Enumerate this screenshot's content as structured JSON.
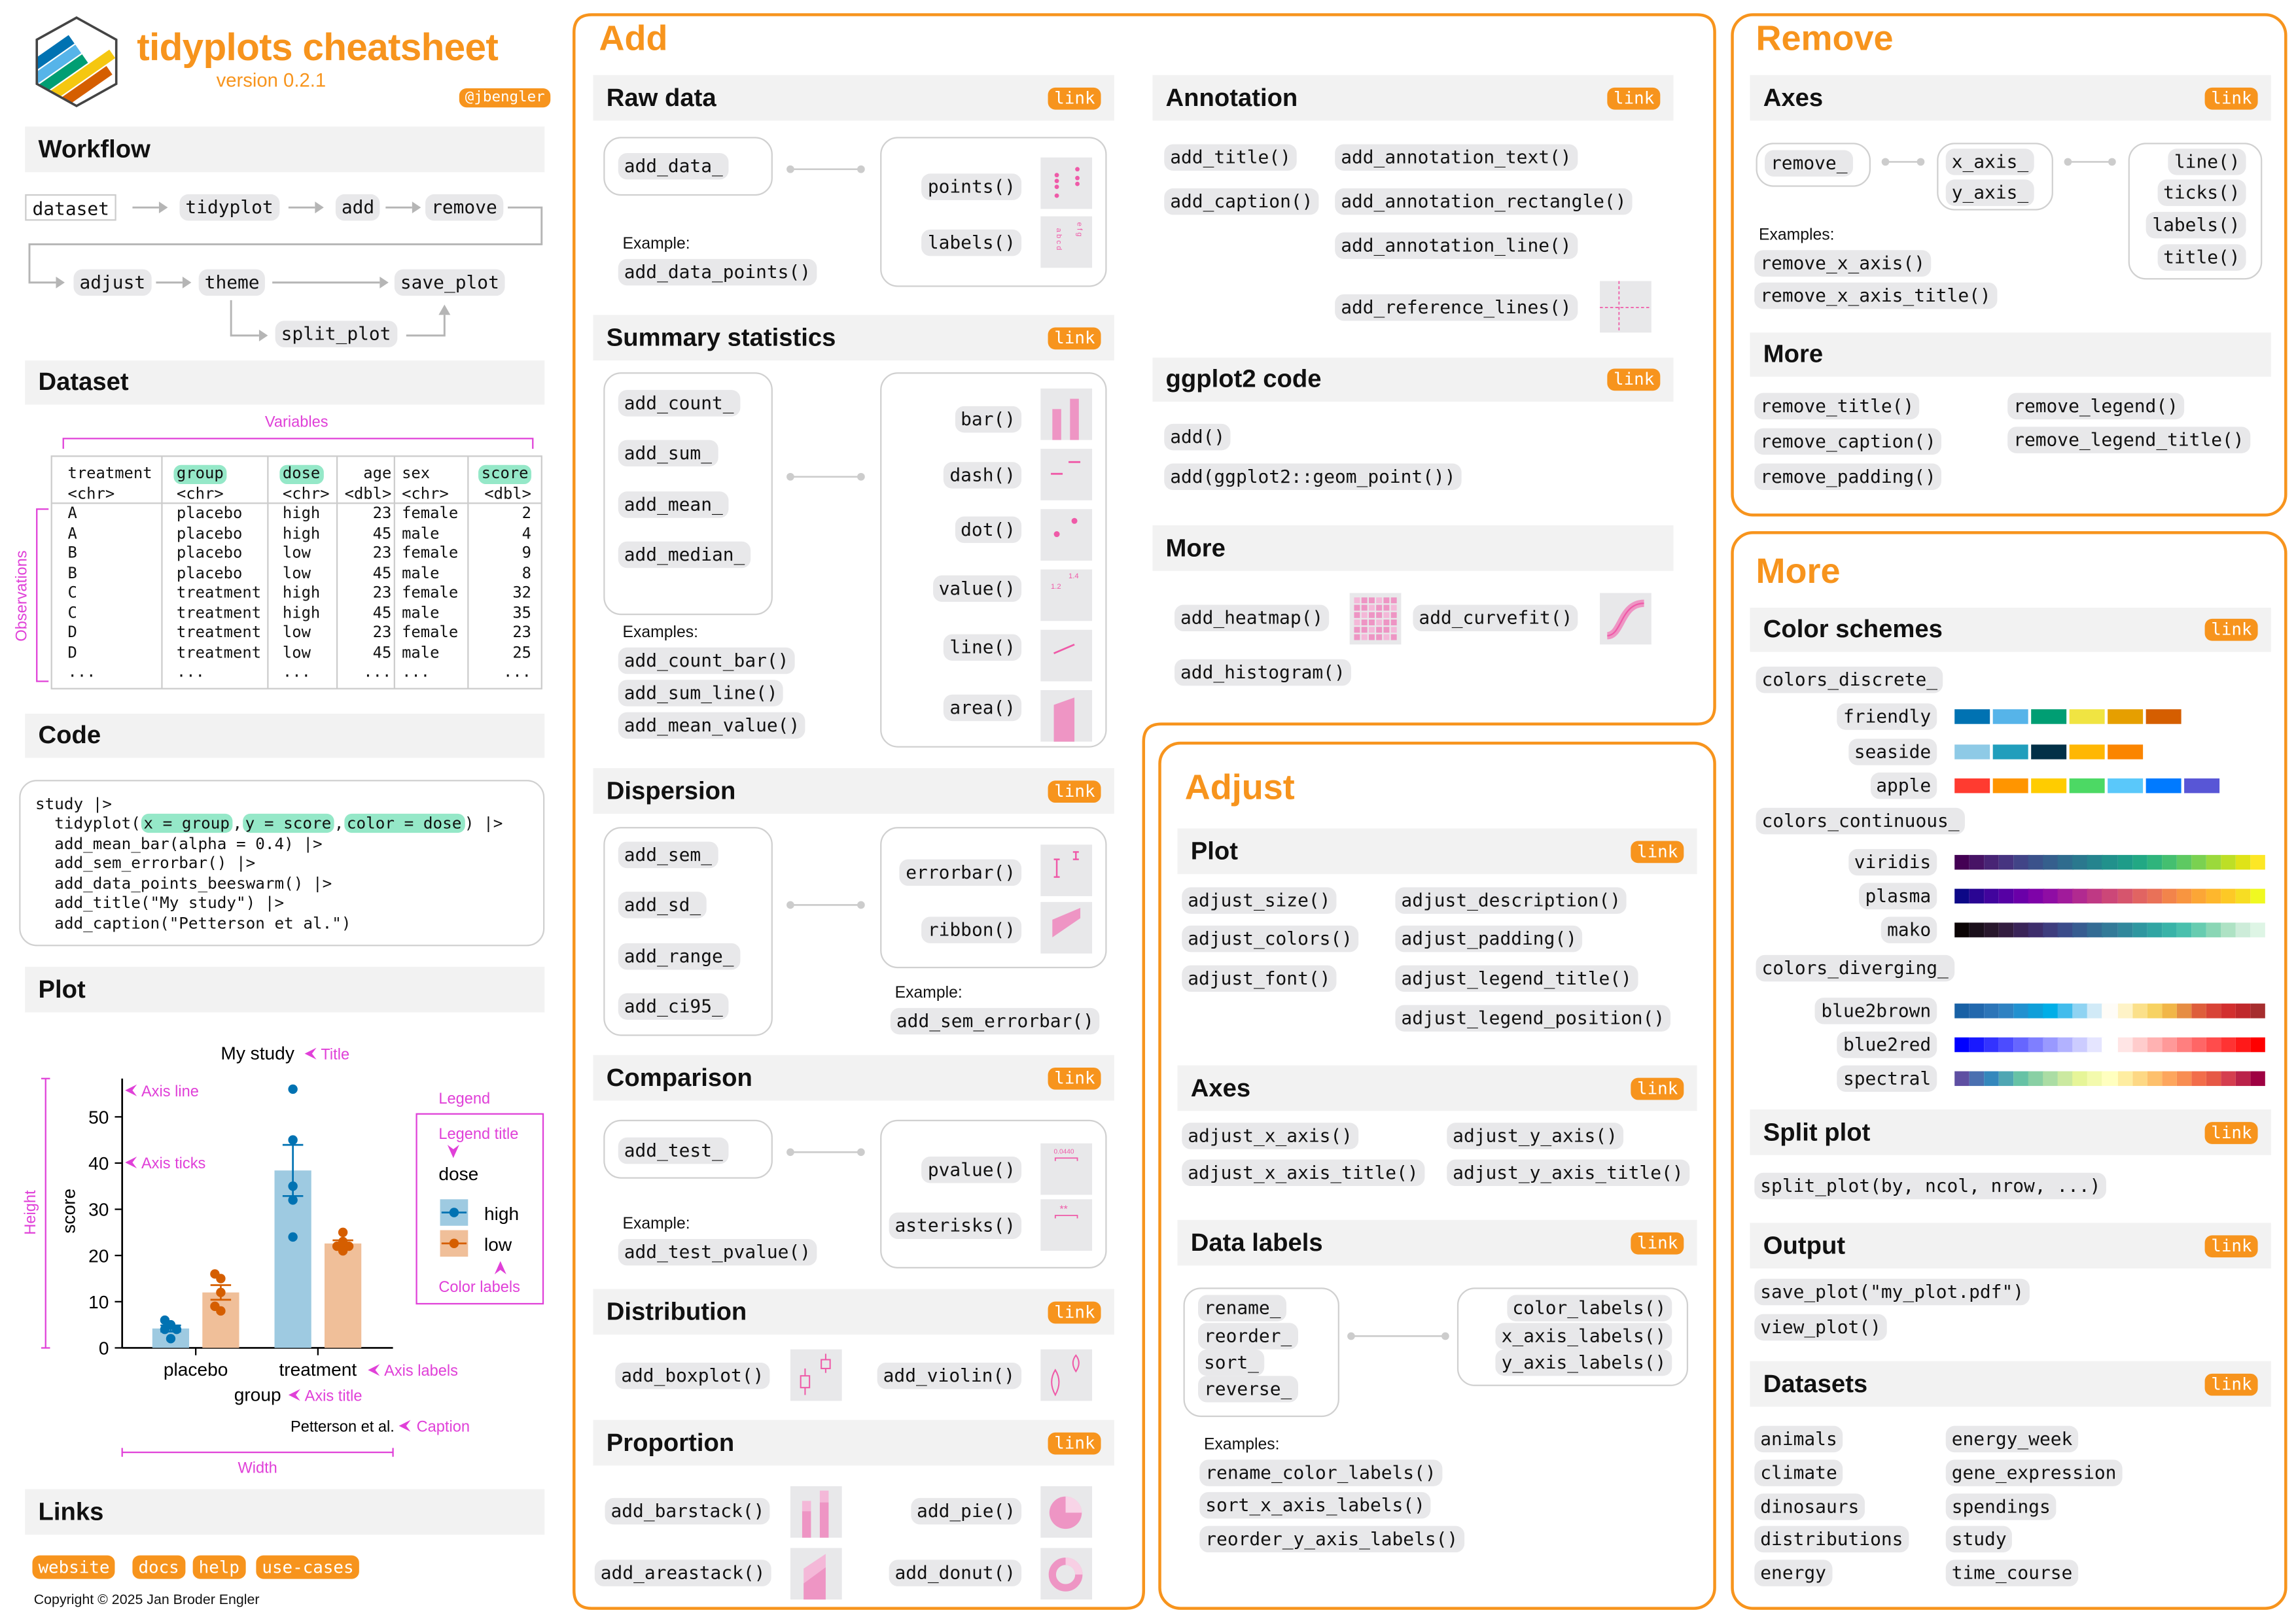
{
  "header": {
    "title": "tidyplots cheatsheet",
    "version": "version 0.2.1",
    "handle": "@jbengler",
    "logo_text": "tidy plots"
  },
  "link_label": "link",
  "brand_color": "#f7941d",
  "annotation_color": "#e040d8",
  "workflow": {
    "title": "Workflow",
    "steps": [
      "dataset",
      "tidyplot",
      "add",
      "remove",
      "adjust",
      "theme",
      "save_plot",
      "split_plot"
    ]
  },
  "dataset": {
    "title": "Dataset",
    "variables_label": "Variables",
    "observations_label": "Observations",
    "columns": [
      {
        "name": "treatment",
        "type": "<chr>",
        "highlight": false
      },
      {
        "name": "group",
        "type": "<chr>",
        "highlight": true
      },
      {
        "name": "dose",
        "type": "<chr>",
        "highlight": true
      },
      {
        "name": "age",
        "type": "<dbl>",
        "highlight": false
      },
      {
        "name": "sex",
        "type": "<chr>",
        "highlight": false
      },
      {
        "name": "score",
        "type": "<dbl>",
        "highlight": true
      }
    ],
    "rows": [
      [
        "A",
        "placebo",
        "high",
        "23",
        "female",
        "2"
      ],
      [
        "A",
        "placebo",
        "high",
        "45",
        "male",
        "4"
      ],
      [
        "B",
        "placebo",
        "low",
        "23",
        "female",
        "9"
      ],
      [
        "B",
        "placebo",
        "low",
        "45",
        "male",
        "8"
      ],
      [
        "C",
        "treatment",
        "high",
        "23",
        "female",
        "32"
      ],
      [
        "C",
        "treatment",
        "high",
        "45",
        "male",
        "35"
      ],
      [
        "D",
        "treatment",
        "low",
        "23",
        "female",
        "23"
      ],
      [
        "D",
        "treatment",
        "low",
        "45",
        "male",
        "25"
      ],
      [
        "...",
        "...",
        "...",
        "...",
        "...",
        "..."
      ]
    ]
  },
  "code": {
    "title": "Code",
    "line1": "study |>",
    "line2": {
      "a": "tidyplot(",
      "x": "x = group",
      "c1": ",",
      "y": "y = score",
      "c2": ",",
      "color": "color = dose",
      "end": ") |>"
    },
    "lines": [
      "add_mean_bar(alpha = 0.4) |>",
      "add_sem_errorbar() |>",
      "add_data_points_beeswarm() |>",
      "add_title(\"My study\") |>",
      "add_caption(\"Petterson et al.\")"
    ]
  },
  "plot": {
    "title": "Plot",
    "annotations": {
      "title": "Title",
      "axis_line": "Axis line",
      "axis_ticks": "Axis ticks",
      "legend": "Legend",
      "legend_title": "Legend title",
      "color_labels": "Color labels",
      "axis_labels": "Axis labels",
      "axis_title": "Axis title",
      "caption": "Caption",
      "width": "Width",
      "height": "Height"
    }
  },
  "chart_data": {
    "type": "bar",
    "title": "My study",
    "xlabel": "group",
    "ylabel": "score",
    "caption": "Petterson et al.",
    "categories": [
      "placebo",
      "treatment"
    ],
    "yticks": [
      0,
      10,
      20,
      30,
      40,
      50
    ],
    "ylim": [
      0,
      58
    ],
    "grid": false,
    "legend": {
      "title": "dose",
      "position": "right"
    },
    "series": [
      {
        "name": "high",
        "color": "#0072B2",
        "bar_color": "#9ecae1",
        "mean": [
          4.2,
          38.4
        ],
        "points": [
          [
            6,
            5,
            4,
            4,
            2
          ],
          [
            56,
            45,
            35,
            32,
            24
          ]
        ]
      },
      {
        "name": "low",
        "color": "#D55E00",
        "bar_color": "#f0bf99",
        "mean": [
          12,
          22.6
        ],
        "points": [
          [
            16,
            15,
            12,
            9,
            8
          ],
          [
            25,
            23,
            22,
            22,
            21
          ]
        ]
      }
    ]
  },
  "links": {
    "title": "Links",
    "items": [
      "website",
      "docs",
      "help",
      "use-cases"
    ],
    "copyright": "Copyright © 2025 Jan Broder Engler"
  },
  "thumbnails": {
    "labels_left": "a b c d",
    "labels_right": "e f g",
    "value_low": "1.2",
    "value_high": "1.4",
    "pvalue": "0.0440",
    "asterisks": "**"
  },
  "add": {
    "title": "Add",
    "raw_data": {
      "title": "Raw data",
      "prefix": "add_data_",
      "suffixes": [
        "points()",
        "labels()"
      ],
      "example_label": "Example:",
      "examples": [
        "add_data_points()"
      ]
    },
    "summary": {
      "title": "Summary statistics",
      "prefixes": [
        "add_count_",
        "add_sum_",
        "add_mean_",
        "add_median_"
      ],
      "suffixes": [
        "bar()",
        "dash()",
        "dot()",
        "value()",
        "line()",
        "area()"
      ],
      "example_label": "Examples:",
      "examples": [
        "add_count_bar()",
        "add_sum_line()",
        "add_mean_value()"
      ]
    },
    "dispersion": {
      "title": "Dispersion",
      "prefixes": [
        "add_sem_",
        "add_sd_",
        "add_range_",
        "add_ci95_"
      ],
      "suffixes": [
        "errorbar()",
        "ribbon()"
      ],
      "example_label": "Example:",
      "examples": [
        "add_sem_errorbar()"
      ]
    },
    "comparison": {
      "title": "Comparison",
      "prefix": "add_test_",
      "suffixes": [
        "pvalue()",
        "asterisks()"
      ],
      "example_label": "Example:",
      "examples": [
        "add_test_pvalue()"
      ]
    },
    "distribution": {
      "title": "Distribution",
      "items": [
        "add_boxplot()",
        "add_violin()"
      ]
    },
    "proportion": {
      "title": "Proportion",
      "items": [
        "add_barstack()",
        "add_pie()",
        "add_areastack()",
        "add_donut()"
      ]
    },
    "annotation": {
      "title": "Annotation",
      "items": [
        "add_title()",
        "add_annotation_text()",
        "add_caption()",
        "add_annotation_rectangle()",
        "add_annotation_line()",
        "add_reference_lines()"
      ]
    },
    "ggplot2": {
      "title": "ggplot2 code",
      "items": [
        "add()",
        "add(ggplot2::geom_point())"
      ]
    },
    "more": {
      "title": "More",
      "items": [
        "add_heatmap()",
        "add_curvefit()",
        "add_histogram()"
      ]
    }
  },
  "adjust": {
    "title": "Adjust",
    "plot": {
      "title": "Plot",
      "items": [
        "adjust_size()",
        "adjust_description()",
        "adjust_colors()",
        "adjust_padding()",
        "adjust_font()",
        "adjust_legend_title()",
        "adjust_legend_position()"
      ]
    },
    "axes": {
      "title": "Axes",
      "items": [
        "adjust_x_axis()",
        "adjust_y_axis()",
        "adjust_x_axis_title()",
        "adjust_y_axis_title()"
      ]
    },
    "data_labels": {
      "title": "Data labels",
      "prefixes": [
        "rename_",
        "reorder_",
        "sort_",
        "reverse_"
      ],
      "suffixes": [
        "color_labels()",
        "x_axis_labels()",
        "y_axis_labels()"
      ],
      "example_label": "Examples:",
      "examples": [
        "rename_color_labels()",
        "sort_x_axis_labels()",
        "reorder_y_axis_labels()"
      ]
    }
  },
  "remove": {
    "title": "Remove",
    "axes": {
      "title": "Axes",
      "prefix": "remove_",
      "middle": [
        "x_axis_",
        "y_axis_"
      ],
      "suffixes": [
        "line()",
        "ticks()",
        "labels()",
        "title()"
      ],
      "example_label": "Examples:",
      "examples": [
        "remove_x_axis()",
        "remove_x_axis_title()"
      ]
    },
    "more": {
      "title": "More",
      "items": [
        "remove_title()",
        "remove_legend()",
        "remove_caption()",
        "remove_legend_title()",
        "remove_padding()"
      ]
    }
  },
  "more": {
    "title": "More",
    "color_schemes": {
      "title": "Color schemes",
      "discrete": {
        "label": "colors_discrete_",
        "schemes": [
          {
            "name": "friendly",
            "colors": [
              "#0072B2",
              "#56B4E9",
              "#009E73",
              "#F0E442",
              "#E69F00",
              "#D55E00"
            ]
          },
          {
            "name": "seaside",
            "colors": [
              "#8ecae6",
              "#219ebc",
              "#023047",
              "#ffb703",
              "#fb8500"
            ]
          },
          {
            "name": "apple",
            "colors": [
              "#FF3B30",
              "#FF9500",
              "#FFCC00",
              "#4CD964",
              "#5AC8FA",
              "#007AFF",
              "#5856D6"
            ]
          }
        ]
      },
      "continuous": {
        "label": "colors_continuous_",
        "schemes": [
          {
            "name": "viridis",
            "colors": [
              "#440154",
              "#471365",
              "#482475",
              "#463480",
              "#414487",
              "#3b528b",
              "#355f8d",
              "#2f6c8e",
              "#2a788e",
              "#25848e",
              "#21918c",
              "#1e9c89",
              "#22a884",
              "#2fb47c",
              "#44bf70",
              "#5ec962",
              "#7ad151",
              "#9bd93c",
              "#bddf26",
              "#dfe318",
              "#fde725"
            ]
          },
          {
            "name": "plasma",
            "colors": [
              "#0d0887",
              "#2a0593",
              "#41049d",
              "#5601a4",
              "#6a00a8",
              "#7e03a8",
              "#8f0da4",
              "#a11b9b",
              "#b12a90",
              "#bf3984",
              "#cc4778",
              "#d6556d",
              "#e16462",
              "#e97158",
              "#f2844b",
              "#f89540",
              "#fca636",
              "#feb72d",
              "#fdc926",
              "#f7dd23",
              "#f0f921"
            ]
          },
          {
            "name": "mako",
            "colors": [
              "#0b0405",
              "#1a0f1b",
              "#28172c",
              "#331d40",
              "#3a2458",
              "#3e2e6c",
              "#3e3d7e",
              "#3b4c8a",
              "#375c90",
              "#346c94",
              "#337a98",
              "#31889c",
              "#2f97a0",
              "#31a5a3",
              "#39b3a8",
              "#4ac0ad",
              "#67ccb0",
              "#8ad6b5",
              "#aee2c4",
              "#cdecd9",
              "#def5e5"
            ]
          }
        ]
      },
      "diverging": {
        "label": "colors_diverging_",
        "schemes": [
          {
            "name": "blue2brown",
            "colors": [
              "#1961A5",
              "#2268AD",
              "#2C75B8",
              "#2F82C2",
              "#2191D0",
              "#0F9FD9",
              "#00AEE7",
              "#42BCEC",
              "#8FD3F2",
              "#D1EAF7",
              "#FEFCF7",
              "#FEF3C7",
              "#FBE08A",
              "#F7D262",
              "#F1B648",
              "#E68D43",
              "#DE5E3B",
              "#D84336",
              "#D22F2E",
              "#C0282B",
              "#A62D2E"
            ]
          },
          {
            "name": "blue2red",
            "colors": [
              "#0000FF",
              "#1919FF",
              "#3333FF",
              "#4C4CFF",
              "#6666FF",
              "#7F7FFF",
              "#9999FF",
              "#B2B2FF",
              "#CCCCFF",
              "#E5E5FF",
              "#FFFFFF",
              "#FFE5E5",
              "#FFCCCC",
              "#FFB2B2",
              "#FF9999",
              "#FF7F7F",
              "#FF6666",
              "#FF4C4C",
              "#FF3333",
              "#FF1919",
              "#FF0000"
            ]
          },
          {
            "name": "spectral",
            "colors": [
              "#5E4FA2",
              "#4A6FB0",
              "#3487BC",
              "#4FA6B3",
              "#66C2A5",
              "#89D0A4",
              "#ABDDA4",
              "#CBE9A0",
              "#E6F598",
              "#F3FAAD",
              "#FFFFBF",
              "#FEEDA1",
              "#FDD884",
              "#FDC06C",
              "#FDA65D",
              "#F88D52",
              "#F26D4A",
              "#E65845",
              "#D53E4F",
              "#BA2249",
              "#9E0142"
            ]
          }
        ]
      }
    },
    "split_plot": {
      "title": "Split plot",
      "items": [
        "split_plot(by, ncol, nrow, ...)"
      ]
    },
    "output": {
      "title": "Output",
      "items": [
        "save_plot(\"my_plot.pdf\")",
        "view_plot()"
      ]
    },
    "datasets": {
      "title": "Datasets",
      "items": [
        "animals",
        "energy_week",
        "climate",
        "gene_expression",
        "dinosaurs",
        "spendings",
        "distributions",
        "study",
        "energy",
        "time_course"
      ]
    }
  }
}
